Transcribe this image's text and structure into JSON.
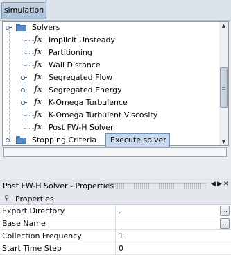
{
  "tab": {
    "label": "simulation"
  },
  "tree": {
    "solvers_label": "Solvers",
    "items": [
      {
        "label": "Implicit Unsteady"
      },
      {
        "label": "Partitioning"
      },
      {
        "label": "Wall Distance"
      },
      {
        "label": "Segregated Flow"
      },
      {
        "label": "Segregated Energy"
      },
      {
        "label": "K-Omega Turbulence"
      },
      {
        "label": "K-Omega Turbulent Viscosity"
      },
      {
        "label": "Post FW-H Solver"
      }
    ],
    "stopping_label": "Stopping Criteria"
  },
  "context_menu": {
    "execute_label": "Execute solver"
  },
  "panel": {
    "title": "Post FW-H Solver - Properties",
    "header": "Properties",
    "controls": [
      "◀",
      "▶",
      "✕"
    ]
  },
  "properties": [
    {
      "name": "Export Directory",
      "value": ".",
      "button": "..."
    },
    {
      "name": "Base Name",
      "value": "",
      "button": "..."
    },
    {
      "name": "Collection Frequency",
      "value": "1"
    },
    {
      "name": "Start Time Step",
      "value": "0"
    }
  ],
  "scroll_arrows": {
    "up": "▲",
    "down": "▼"
  },
  "colors": {
    "folder": "#5d8bc2",
    "selection": "#c8d8ea",
    "tab": "#b7cadf"
  }
}
